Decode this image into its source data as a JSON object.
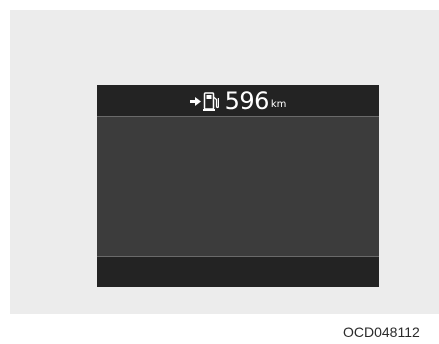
{
  "cluster_display": {
    "fuel_range": {
      "value": "596",
      "unit": "km",
      "icons": [
        "arrow-right-icon",
        "fuel-pump-icon"
      ]
    }
  },
  "figure_code": "OCD048112",
  "colors": {
    "panel_background": "#ececec",
    "display_background": "#3c3c3c",
    "display_bar": "#232323",
    "display_text": "#ffffff"
  }
}
